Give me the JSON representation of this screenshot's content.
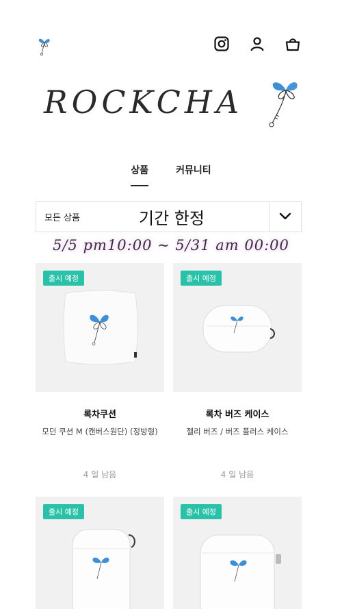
{
  "header": {
    "icons": [
      "clover-logo-icon",
      "instagram-icon",
      "user-icon",
      "shopping-bag-icon"
    ]
  },
  "brand": {
    "name": "ROCKCHA"
  },
  "tabs": [
    {
      "label": "상품",
      "active": true
    },
    {
      "label": "커뮤니티",
      "active": false
    }
  ],
  "filter": {
    "category": "모든 상품",
    "title": "기간 한정",
    "toggle_icon": "chevron-down-icon"
  },
  "banner": {
    "text": "5/5 pm10:00 ~ 5/31 am 00:00"
  },
  "products": [
    {
      "badge": "출시 예정",
      "name": "록차쿠션",
      "desc": "모던 쿠션 M (캔버스원단) (정방형)",
      "remaining": "4 일 남음",
      "image": "cushion"
    },
    {
      "badge": "출시 예정",
      "name": "록차 버즈 케이스",
      "desc": "젤리 버즈 / 버즈 플러스 케이스",
      "remaining": "4 일 남음",
      "image": "buds-case"
    },
    {
      "badge": "출시 예정",
      "name": "",
      "desc": "",
      "remaining": "",
      "image": "airpods-case"
    },
    {
      "badge": "출시 예정",
      "name": "",
      "desc": "",
      "remaining": "",
      "image": "airpods-pro-case"
    }
  ],
  "colors": {
    "accent": "#29c1a7",
    "clover_blue": "#3d8fd6"
  }
}
